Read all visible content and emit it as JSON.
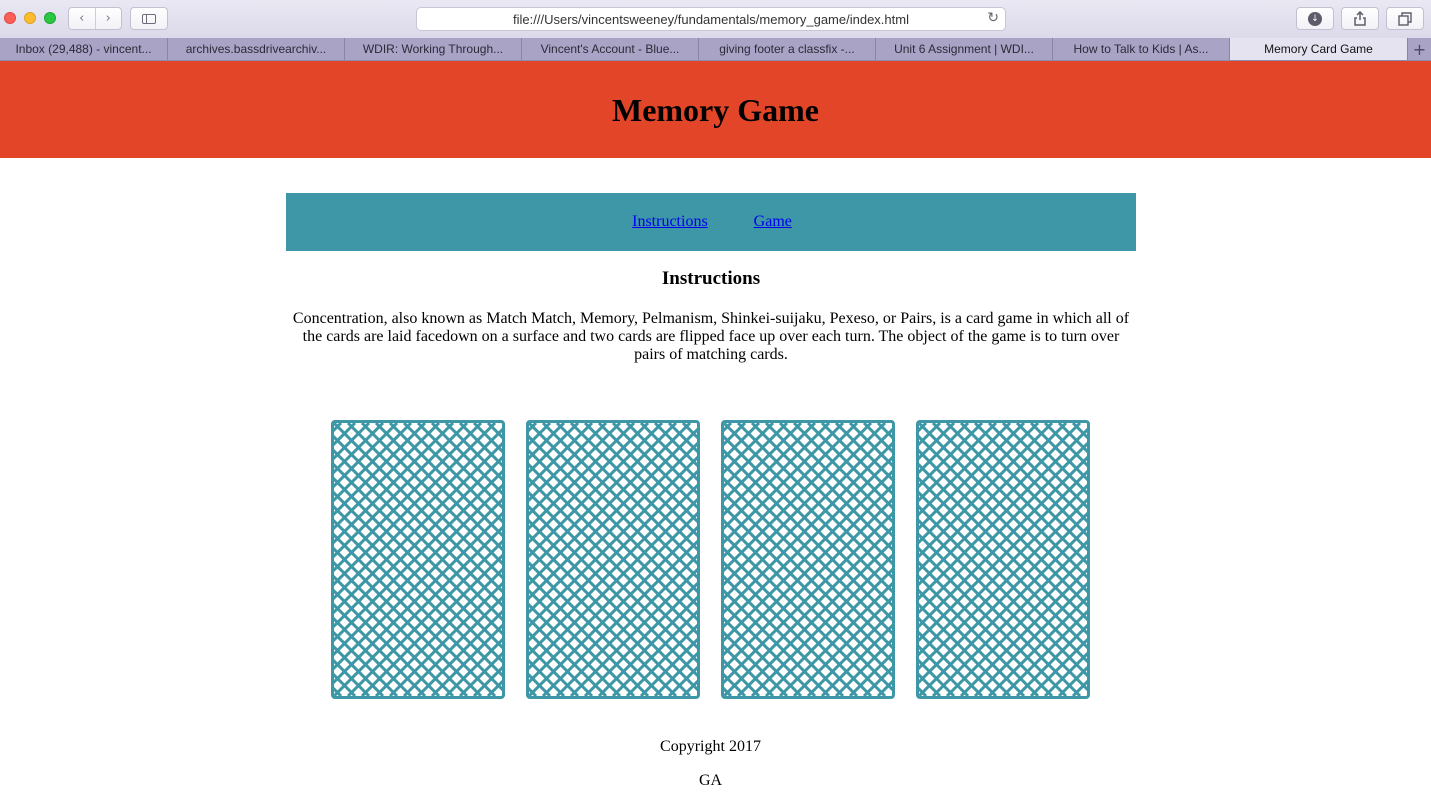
{
  "browser": {
    "url": "file:///Users/vincentsweeney/fundamentals/memory_game/index.html",
    "tabs": [
      {
        "label": "Inbox (29,488) - vincent..."
      },
      {
        "label": "archives.bassdrivearchiv..."
      },
      {
        "label": "WDIR: Working Through..."
      },
      {
        "label": "Vincent's Account - Blue..."
      },
      {
        "label": "giving footer a classfix -..."
      },
      {
        "label": "Unit 6 Assignment | WDI..."
      },
      {
        "label": "How to Talk to Kids | As..."
      },
      {
        "label": "Memory Card Game"
      }
    ],
    "active_tab": "Memory Card Game",
    "icons": [
      "back-icon",
      "forward-icon",
      "sidebar-icon",
      "reload-icon",
      "download-icon",
      "share-icon",
      "tabs-overview-icon",
      "new-tab-icon"
    ]
  },
  "page": {
    "title": "Memory Game",
    "header_color": "#e34528",
    "nav": {
      "instructions_label": "Instructions",
      "game_label": "Game",
      "color": "#3d97a6"
    },
    "instructions_heading": "Instructions",
    "instructions_text": "Concentration, also known as Match Match, Memory, Pelmanism, Shinkei-suijaku, Pexeso, or Pairs, is a card game in which all of the cards are laid facedown on a surface and two cards are flipped face up over each turn. The object of the game is to turn over pairs of matching cards.",
    "cards": [
      {
        "state": "face-down"
      },
      {
        "state": "face-down"
      },
      {
        "state": "face-down"
      },
      {
        "state": "face-down"
      }
    ],
    "card_color": "#3d97a6",
    "footer": {
      "copyright": "Copyright 2017",
      "author": "GA"
    }
  }
}
